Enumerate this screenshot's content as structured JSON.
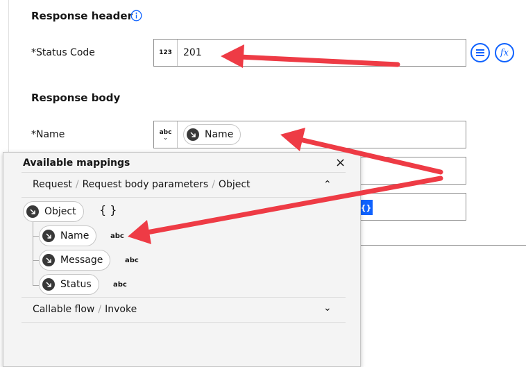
{
  "response_header": {
    "title": "Response header",
    "status_label": "*Status Code",
    "status_type": "123",
    "status_value": "201"
  },
  "response_body": {
    "title": "Response body",
    "name_label": "*Name",
    "name_type": "abc",
    "name_chip": "Name",
    "blue_button_label": "{}"
  },
  "mappings_panel": {
    "title": "Available mappings",
    "close": "×",
    "request_section": {
      "crumbs": [
        "Request",
        "Request body parameters",
        "Object"
      ],
      "separator": "/",
      "object_chip": "Object",
      "object_type": "{ }",
      "children": [
        {
          "label": "Name",
          "type": "abc"
        },
        {
          "label": "Message",
          "type": "abc"
        },
        {
          "label": "Status",
          "type": "abc"
        }
      ]
    },
    "callable_section": {
      "crumbs": [
        "Callable flow",
        "Invoke"
      ],
      "separator": "/"
    }
  },
  "colors": {
    "accent": "#0f62fe",
    "annotation_arrow": "#ee3b45",
    "panel_bg": "#f4f4f4"
  },
  "icons": [
    "info-icon",
    "list-icon",
    "fx-icon",
    "mapping-arrow-icon",
    "chevron-up-icon",
    "chevron-down-icon",
    "close-icon"
  ]
}
